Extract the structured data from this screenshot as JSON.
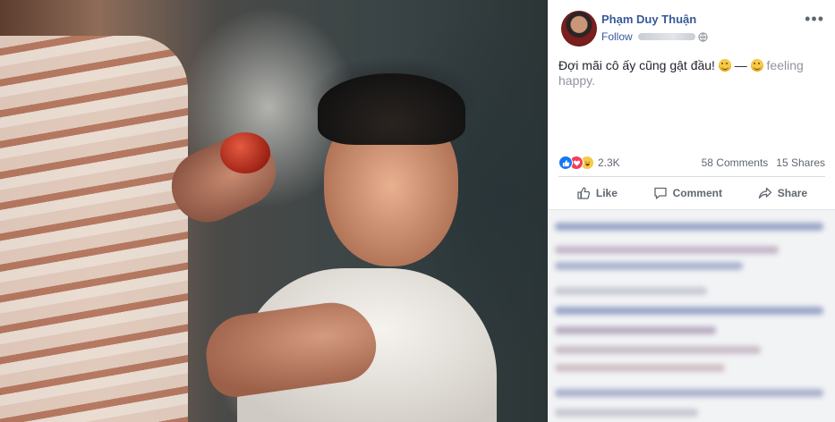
{
  "post": {
    "author": "Phạm Duy Thuận",
    "follow_label": "Follow",
    "more_label": "•••",
    "message_text": "Đợi mãi cô ấy cũng gật đầu!",
    "feeling_separator": "—",
    "feeling_text": "feeling happy.",
    "reactions_count": "2.3K",
    "comments_count": "58 Comments",
    "shares_count": "15 Shares"
  },
  "actions": {
    "like_label": "Like",
    "comment_label": "Comment",
    "share_label": "Share"
  },
  "colors": {
    "link_blue": "#365899",
    "secondary_text": "#606770",
    "like_blue": "#1877f2",
    "love_red": "#f33e58",
    "haha_yellow": "#f7c948"
  },
  "icons": {
    "globe": "globe-icon",
    "more": "more-options-icon",
    "like": "thumbs-up-icon",
    "comment": "speech-bubble-icon",
    "share": "share-arrow-icon"
  }
}
